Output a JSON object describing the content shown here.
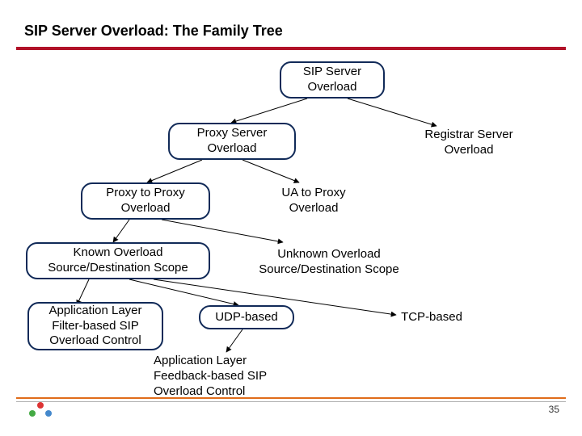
{
  "slide": {
    "title": "SIP Server Overload: The Family Tree",
    "page_number": "35"
  },
  "nodes": {
    "root": "SIP Server\nOverload",
    "proxy": "Proxy Server\nOverload",
    "registrar": "Registrar Server\nOverload",
    "p2p": "Proxy to Proxy\nOverload",
    "ua2p": "UA to Proxy\nOverload",
    "known": "Known Overload\nSource/Destination Scope",
    "unknown": "Unknown Overload\nSource/Destination Scope",
    "filter": "Application Layer\nFilter-based SIP\nOverload Control",
    "udp": "UDP-based",
    "tcp": "TCP-based",
    "feedback": "Application Layer\nFeedback-based SIP\nOverload Control"
  }
}
